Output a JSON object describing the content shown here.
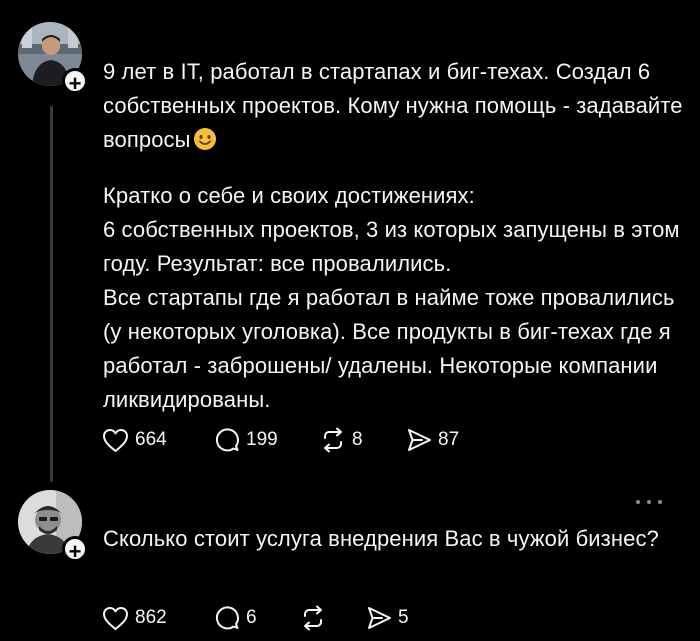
{
  "posts": [
    {
      "paragraph1": "9 лет в IT, работал в стартапах и биг-техах. Создал 6 собственных проектов. Кому нужна помощь - задавайте вопросы",
      "emoji": "smiling-face-emoji",
      "paragraph2": "Кратко о себе и своих достижениях:",
      "paragraph3": "6 собственных проектов, 3 из которых запущены в этом году. Результат: все провалились.",
      "paragraph4": "Все стартапы где я работал в найме тоже провалились (у некоторых уголовка). Все продукты в биг-техах где я работал - заброшены/ удалены. Некоторые компании ликвидированы.",
      "likes": "664",
      "comments": "199",
      "reposts": "8",
      "shares": "87"
    },
    {
      "paragraph1": "Сколько стоит услуга внедрения Вас в чужой бизнес?",
      "likes": "862",
      "comments": "6",
      "reposts": "",
      "shares": "5"
    }
  ],
  "follow_symbol": "+",
  "colors": {
    "background": "#000000",
    "text": "#f3f5f7",
    "thread_line": "#3a3a3a",
    "more_dots": "#8a8a8a"
  }
}
